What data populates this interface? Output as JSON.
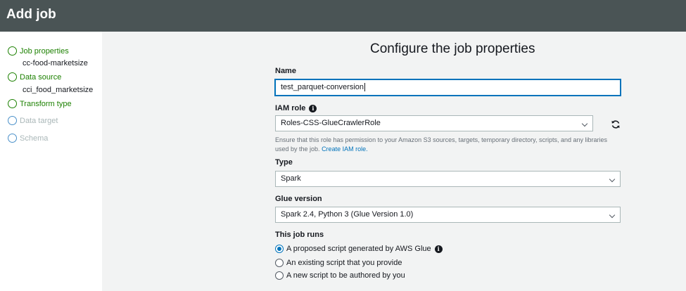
{
  "header": {
    "title": "Add job"
  },
  "sidebar": {
    "steps": [
      {
        "label": "Job properties",
        "sub": "cc-food-marketsize",
        "state": "done"
      },
      {
        "label": "Data source",
        "sub": "cci_food_marketsize",
        "state": "done"
      },
      {
        "label": "Transform type",
        "sub": "",
        "state": "done"
      },
      {
        "label": "Data target",
        "sub": "",
        "state": "todo"
      },
      {
        "label": "Schema",
        "sub": "",
        "state": "todo"
      }
    ]
  },
  "main": {
    "title": "Configure the job properties",
    "name": {
      "label": "Name",
      "value": "test_parquet-conversion"
    },
    "iam": {
      "label": "IAM role",
      "value": "Roles-CSS-GlueCrawlerRole",
      "help": "Ensure that this role has permission to your Amazon S3 sources, targets, temporary directory, scripts, and any libraries used by the job.",
      "help_link": "Create IAM role."
    },
    "type": {
      "label": "Type",
      "value": "Spark"
    },
    "glue_version": {
      "label": "Glue version",
      "value": "Spark 2.4, Python 3 (Glue Version 1.0)"
    },
    "job_runs": {
      "label": "This job runs",
      "options": [
        {
          "label": "A proposed script generated by AWS Glue",
          "checked": true
        },
        {
          "label": "An existing script that you provide",
          "checked": false
        },
        {
          "label": "A new script to be authored by you",
          "checked": false
        }
      ]
    }
  },
  "colors": {
    "header_bg": "#4a5455",
    "accent": "#0073bb",
    "step_done": "#1d8102",
    "step_todo": "#aab7b8"
  },
  "icons": {
    "info": "info-icon",
    "refresh": "refresh-icon",
    "chevron": "chevron-down-icon"
  }
}
